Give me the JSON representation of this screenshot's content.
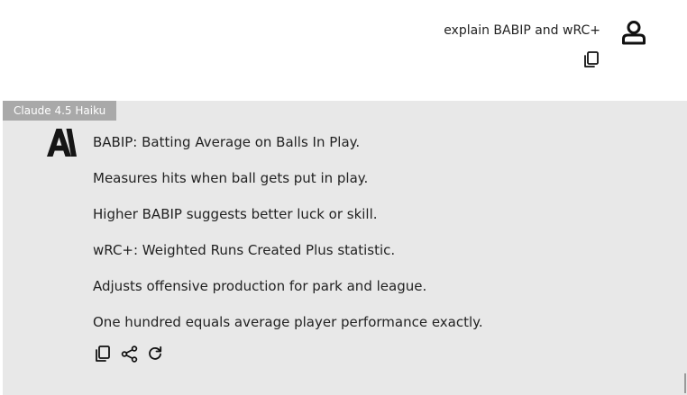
{
  "user_message": {
    "text": "explain BABIP and wRC+",
    "avatar_icon": "user-icon",
    "copy_icon": "copy-icon"
  },
  "assistant": {
    "model_badge": "Claude 4.5 Haiku",
    "logo_icon": "anthropic-logo-icon",
    "paragraphs": [
      "BABIP: Batting Average on Balls In Play.",
      "Measures hits when ball gets put in play.",
      "Higher BABIP suggests better luck or skill.",
      "wRC+: Weighted Runs Created Plus statistic.",
      "Adjusts offensive production for park and league.",
      "One hundred equals average player performance exactly."
    ],
    "actions": [
      "copy-icon",
      "share-icon",
      "regenerate-icon"
    ]
  },
  "colors": {
    "assistant_bg": "#e8e8e8",
    "badge_bg": "#a9a9a9",
    "text": "#222222"
  }
}
